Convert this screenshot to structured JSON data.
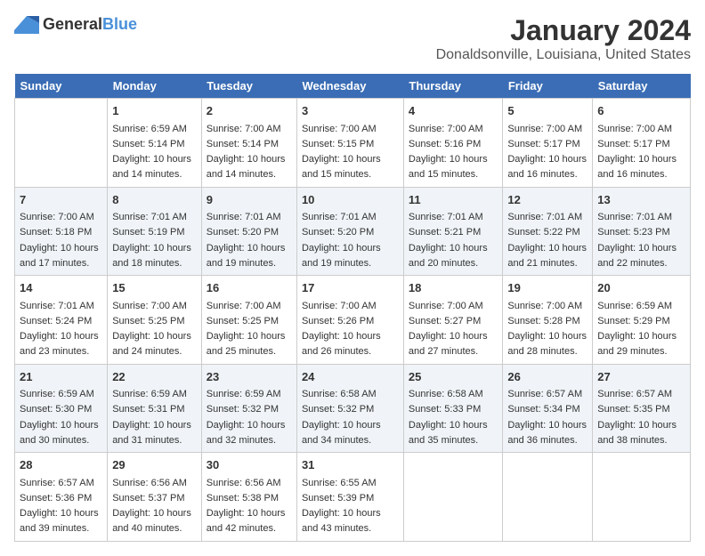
{
  "logo": {
    "general": "General",
    "blue": "Blue"
  },
  "title": "January 2024",
  "subtitle": "Donaldsonville, Louisiana, United States",
  "days_of_week": [
    "Sunday",
    "Monday",
    "Tuesday",
    "Wednesday",
    "Thursday",
    "Friday",
    "Saturday"
  ],
  "weeks": [
    [
      {
        "num": "",
        "sunrise": "",
        "sunset": "",
        "daylight": ""
      },
      {
        "num": "1",
        "sunrise": "Sunrise: 6:59 AM",
        "sunset": "Sunset: 5:14 PM",
        "daylight": "Daylight: 10 hours and 14 minutes."
      },
      {
        "num": "2",
        "sunrise": "Sunrise: 7:00 AM",
        "sunset": "Sunset: 5:14 PM",
        "daylight": "Daylight: 10 hours and 14 minutes."
      },
      {
        "num": "3",
        "sunrise": "Sunrise: 7:00 AM",
        "sunset": "Sunset: 5:15 PM",
        "daylight": "Daylight: 10 hours and 15 minutes."
      },
      {
        "num": "4",
        "sunrise": "Sunrise: 7:00 AM",
        "sunset": "Sunset: 5:16 PM",
        "daylight": "Daylight: 10 hours and 15 minutes."
      },
      {
        "num": "5",
        "sunrise": "Sunrise: 7:00 AM",
        "sunset": "Sunset: 5:17 PM",
        "daylight": "Daylight: 10 hours and 16 minutes."
      },
      {
        "num": "6",
        "sunrise": "Sunrise: 7:00 AM",
        "sunset": "Sunset: 5:17 PM",
        "daylight": "Daylight: 10 hours and 16 minutes."
      }
    ],
    [
      {
        "num": "7",
        "sunrise": "Sunrise: 7:00 AM",
        "sunset": "Sunset: 5:18 PM",
        "daylight": "Daylight: 10 hours and 17 minutes."
      },
      {
        "num": "8",
        "sunrise": "Sunrise: 7:01 AM",
        "sunset": "Sunset: 5:19 PM",
        "daylight": "Daylight: 10 hours and 18 minutes."
      },
      {
        "num": "9",
        "sunrise": "Sunrise: 7:01 AM",
        "sunset": "Sunset: 5:20 PM",
        "daylight": "Daylight: 10 hours and 19 minutes."
      },
      {
        "num": "10",
        "sunrise": "Sunrise: 7:01 AM",
        "sunset": "Sunset: 5:20 PM",
        "daylight": "Daylight: 10 hours and 19 minutes."
      },
      {
        "num": "11",
        "sunrise": "Sunrise: 7:01 AM",
        "sunset": "Sunset: 5:21 PM",
        "daylight": "Daylight: 10 hours and 20 minutes."
      },
      {
        "num": "12",
        "sunrise": "Sunrise: 7:01 AM",
        "sunset": "Sunset: 5:22 PM",
        "daylight": "Daylight: 10 hours and 21 minutes."
      },
      {
        "num": "13",
        "sunrise": "Sunrise: 7:01 AM",
        "sunset": "Sunset: 5:23 PM",
        "daylight": "Daylight: 10 hours and 22 minutes."
      }
    ],
    [
      {
        "num": "14",
        "sunrise": "Sunrise: 7:01 AM",
        "sunset": "Sunset: 5:24 PM",
        "daylight": "Daylight: 10 hours and 23 minutes."
      },
      {
        "num": "15",
        "sunrise": "Sunrise: 7:00 AM",
        "sunset": "Sunset: 5:25 PM",
        "daylight": "Daylight: 10 hours and 24 minutes."
      },
      {
        "num": "16",
        "sunrise": "Sunrise: 7:00 AM",
        "sunset": "Sunset: 5:25 PM",
        "daylight": "Daylight: 10 hours and 25 minutes."
      },
      {
        "num": "17",
        "sunrise": "Sunrise: 7:00 AM",
        "sunset": "Sunset: 5:26 PM",
        "daylight": "Daylight: 10 hours and 26 minutes."
      },
      {
        "num": "18",
        "sunrise": "Sunrise: 7:00 AM",
        "sunset": "Sunset: 5:27 PM",
        "daylight": "Daylight: 10 hours and 27 minutes."
      },
      {
        "num": "19",
        "sunrise": "Sunrise: 7:00 AM",
        "sunset": "Sunset: 5:28 PM",
        "daylight": "Daylight: 10 hours and 28 minutes."
      },
      {
        "num": "20",
        "sunrise": "Sunrise: 6:59 AM",
        "sunset": "Sunset: 5:29 PM",
        "daylight": "Daylight: 10 hours and 29 minutes."
      }
    ],
    [
      {
        "num": "21",
        "sunrise": "Sunrise: 6:59 AM",
        "sunset": "Sunset: 5:30 PM",
        "daylight": "Daylight: 10 hours and 30 minutes."
      },
      {
        "num": "22",
        "sunrise": "Sunrise: 6:59 AM",
        "sunset": "Sunset: 5:31 PM",
        "daylight": "Daylight: 10 hours and 31 minutes."
      },
      {
        "num": "23",
        "sunrise": "Sunrise: 6:59 AM",
        "sunset": "Sunset: 5:32 PM",
        "daylight": "Daylight: 10 hours and 32 minutes."
      },
      {
        "num": "24",
        "sunrise": "Sunrise: 6:58 AM",
        "sunset": "Sunset: 5:32 PM",
        "daylight": "Daylight: 10 hours and 34 minutes."
      },
      {
        "num": "25",
        "sunrise": "Sunrise: 6:58 AM",
        "sunset": "Sunset: 5:33 PM",
        "daylight": "Daylight: 10 hours and 35 minutes."
      },
      {
        "num": "26",
        "sunrise": "Sunrise: 6:57 AM",
        "sunset": "Sunset: 5:34 PM",
        "daylight": "Daylight: 10 hours and 36 minutes."
      },
      {
        "num": "27",
        "sunrise": "Sunrise: 6:57 AM",
        "sunset": "Sunset: 5:35 PM",
        "daylight": "Daylight: 10 hours and 38 minutes."
      }
    ],
    [
      {
        "num": "28",
        "sunrise": "Sunrise: 6:57 AM",
        "sunset": "Sunset: 5:36 PM",
        "daylight": "Daylight: 10 hours and 39 minutes."
      },
      {
        "num": "29",
        "sunrise": "Sunrise: 6:56 AM",
        "sunset": "Sunset: 5:37 PM",
        "daylight": "Daylight: 10 hours and 40 minutes."
      },
      {
        "num": "30",
        "sunrise": "Sunrise: 6:56 AM",
        "sunset": "Sunset: 5:38 PM",
        "daylight": "Daylight: 10 hours and 42 minutes."
      },
      {
        "num": "31",
        "sunrise": "Sunrise: 6:55 AM",
        "sunset": "Sunset: 5:39 PM",
        "daylight": "Daylight: 10 hours and 43 minutes."
      },
      {
        "num": "",
        "sunrise": "",
        "sunset": "",
        "daylight": ""
      },
      {
        "num": "",
        "sunrise": "",
        "sunset": "",
        "daylight": ""
      },
      {
        "num": "",
        "sunrise": "",
        "sunset": "",
        "daylight": ""
      }
    ]
  ]
}
